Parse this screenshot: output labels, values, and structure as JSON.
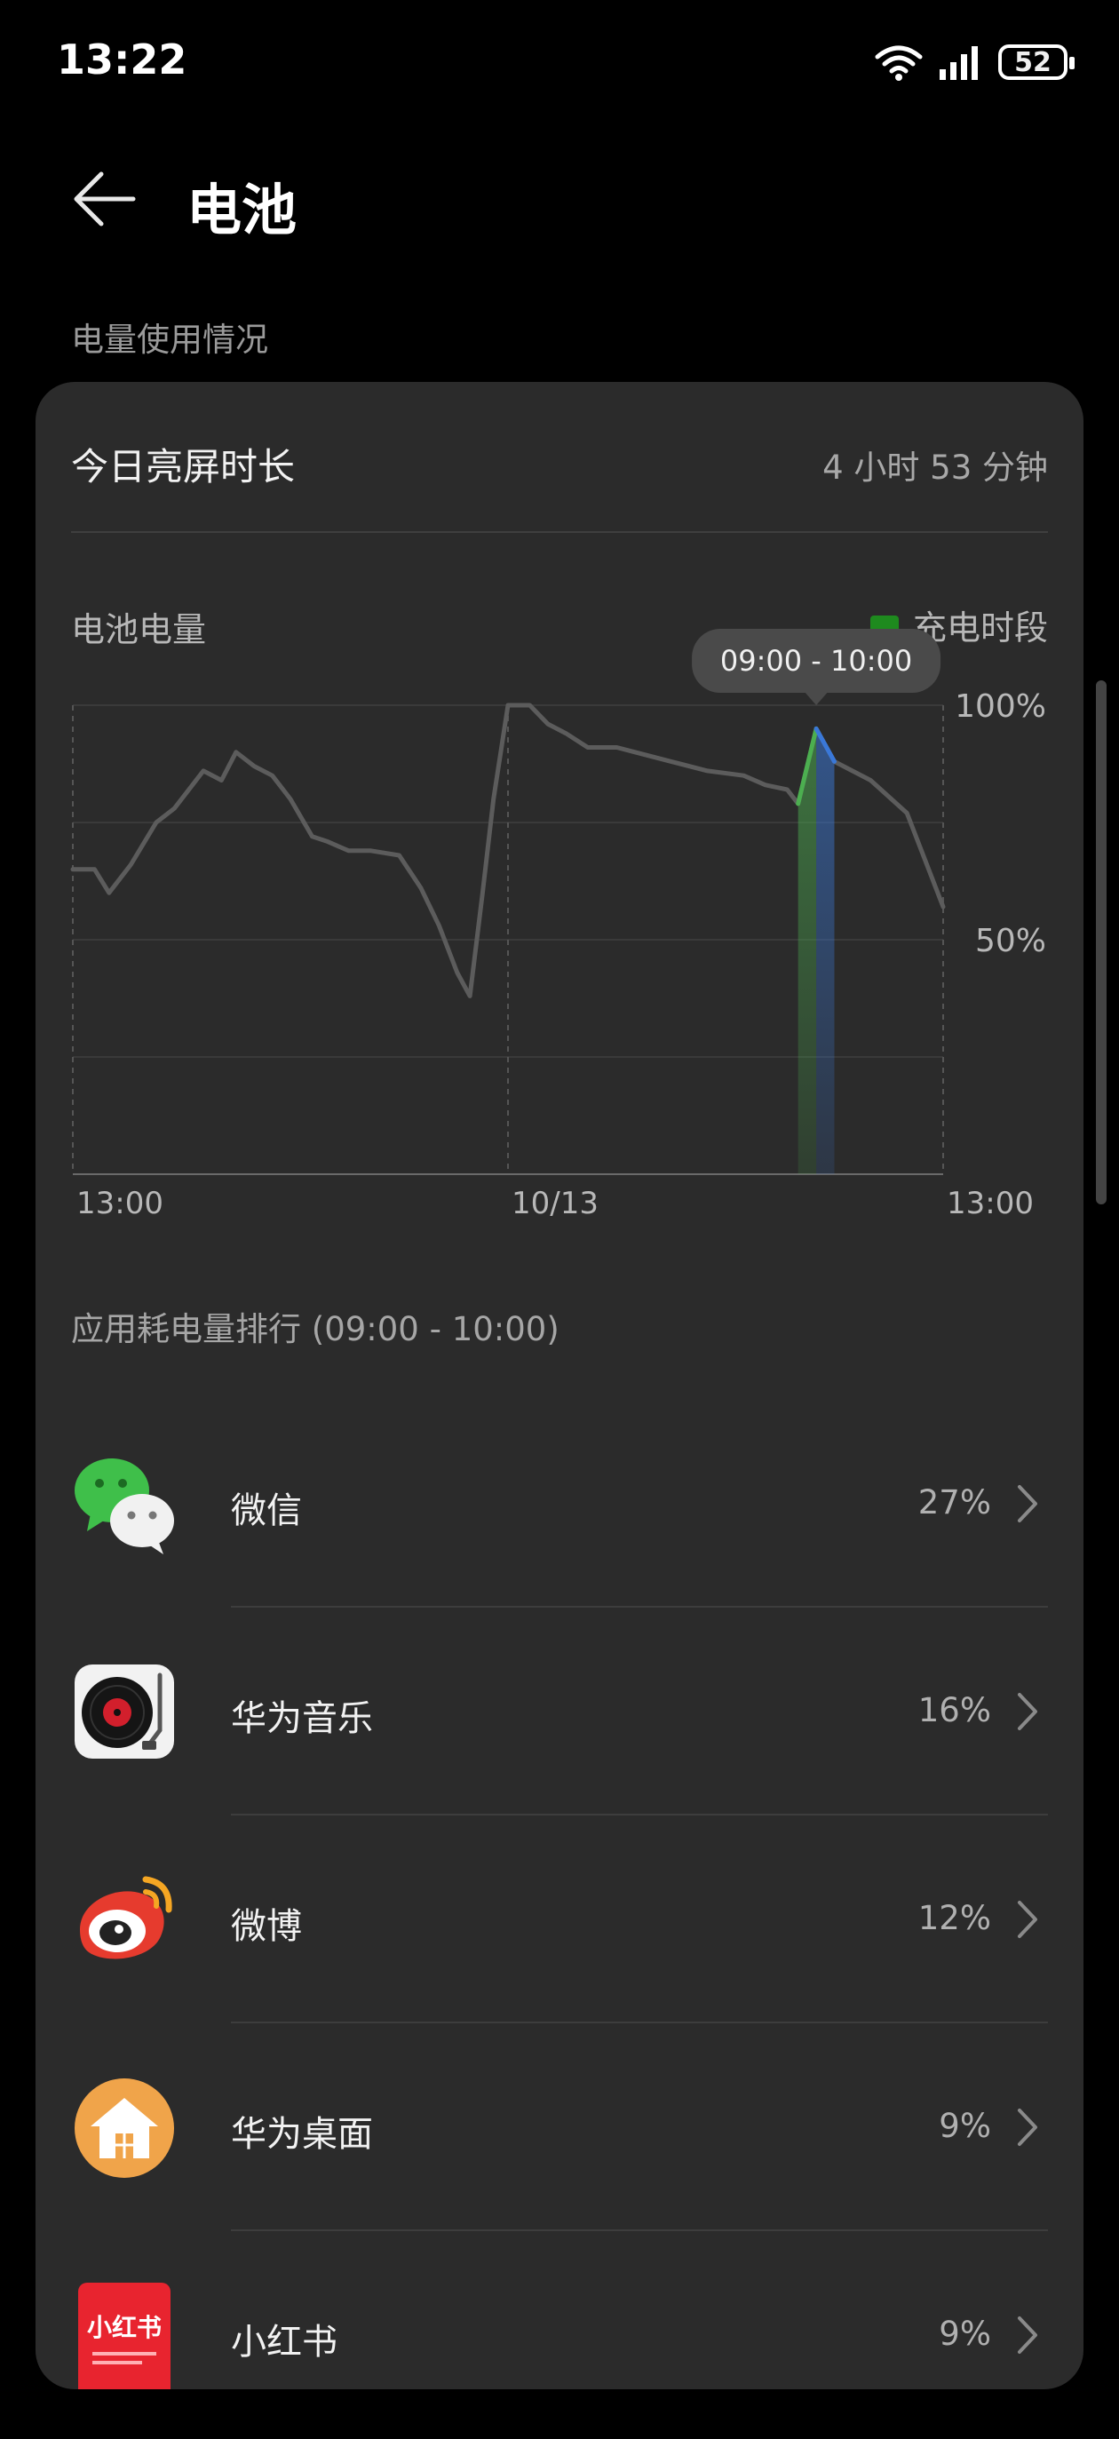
{
  "status_bar": {
    "time": "13:22",
    "battery": "52"
  },
  "header": {
    "title": "电池"
  },
  "section": {
    "label": "电量使用情况"
  },
  "screen_time": {
    "label": "今日亮屏时长",
    "value": "4 小时 53 分钟"
  },
  "chart_section": {
    "label": "电池电量",
    "legend_label": "充电时段",
    "tooltip": "09:00 - 10:00"
  },
  "chart_data": {
    "type": "line",
    "x_tick_labels": [
      "13:00",
      "10/13",
      "13:00"
    ],
    "y_tick_labels": [
      "100%",
      "50%"
    ],
    "ylim": [
      0,
      100
    ],
    "x_range_hours": [
      0,
      24
    ],
    "grid": true,
    "legend": "top-right",
    "series": [
      {
        "x": [
          0,
          0.6,
          1.0,
          1.6,
          2.3,
          2.8,
          3.6,
          4.1,
          4.5,
          5.0,
          5.5,
          6.0,
          6.6,
          7.0,
          7.6,
          8.2,
          9.0,
          9.6,
          10.1,
          10.6,
          10.95,
          11.3,
          11.6,
          12.0,
          12.6,
          13.1,
          13.6,
          14.2,
          15.0,
          15.5,
          16.5,
          17.5,
          18.5,
          19.1,
          19.7,
          20.0,
          20.5
        ],
        "y": [
          65,
          65,
          60,
          66,
          75,
          78,
          86,
          84,
          90,
          87,
          85,
          80,
          72,
          71,
          69,
          69,
          68,
          61,
          53,
          43,
          38,
          60,
          80,
          100,
          100,
          96,
          94,
          91,
          91,
          90,
          88,
          86,
          85,
          83,
          82,
          79,
          95
        ]
      },
      {
        "x": [
          20.5,
          21.0,
          22.0,
          23.0,
          24.0
        ],
        "y": [
          95,
          88,
          84,
          77,
          57
        ]
      }
    ],
    "charging_period": [
      20.0,
      20.5
    ],
    "selected_period": [
      20.5,
      21.0
    ],
    "colors": {
      "line": "#5c5c5c",
      "charging": "#4caf50",
      "selected": "#3a78d8"
    }
  },
  "ranking": {
    "title": "应用耗电量排行 (09:00 - 10:00)",
    "apps": [
      {
        "name": "微信",
        "percent": "27%",
        "icon": "wechat-icon"
      },
      {
        "name": "华为音乐",
        "percent": "16%",
        "icon": "music-icon"
      },
      {
        "name": "微博",
        "percent": "12%",
        "icon": "weibo-icon"
      },
      {
        "name": "华为桌面",
        "percent": "9%",
        "icon": "home-launcher-icon"
      },
      {
        "name": "小红书",
        "percent": "9%",
        "icon": "xiaohongshu-icon",
        "icon_text": "小红书"
      }
    ]
  }
}
